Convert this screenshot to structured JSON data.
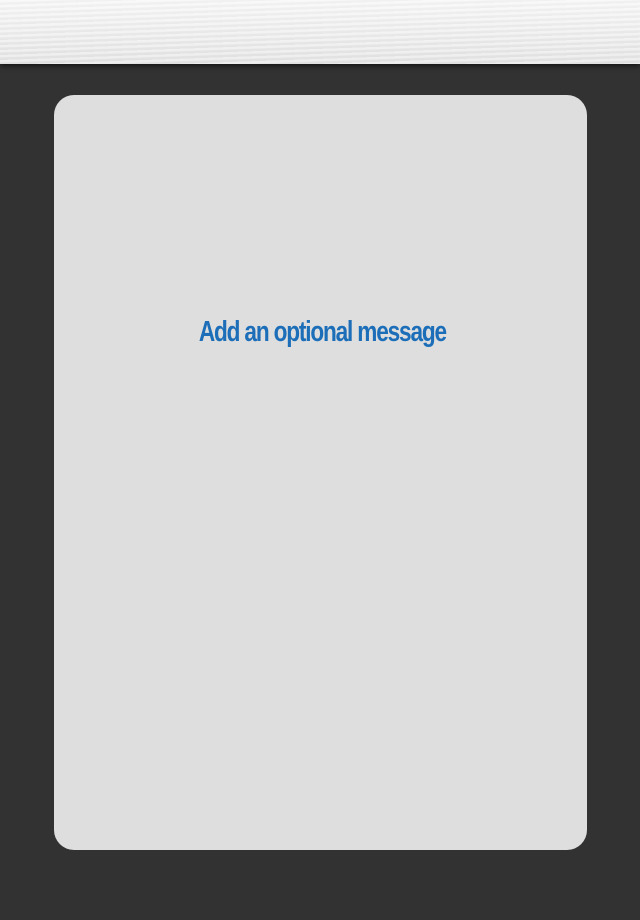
{
  "compose": {
    "message_prompt": "Add an optional message"
  },
  "colors": {
    "background": "#323232",
    "card": "#dedede",
    "accent_text": "#1c6eb8"
  }
}
